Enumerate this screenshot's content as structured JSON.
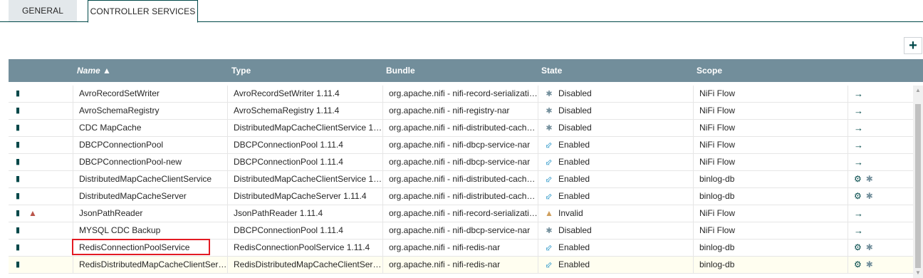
{
  "tabs": [
    {
      "label": "GENERAL"
    },
    {
      "label": "CONTROLLER SERVICES"
    }
  ],
  "add_button": {
    "label": "+"
  },
  "columns": {
    "name": "Name ▲",
    "type": "Type",
    "bundle": "Bundle",
    "state": "State",
    "scope": "Scope"
  },
  "rows": [
    {
      "name": "AvroRecordSetWriter",
      "type": "AvroRecordSetWriter 1.11.4",
      "bundle": "org.apache.nifi - nifi-record-serializati…",
      "state": "Disabled",
      "scope": "NiFi Flow"
    },
    {
      "name": "AvroSchemaRegistry",
      "type": "AvroSchemaRegistry 1.11.4",
      "bundle": "org.apache.nifi - nifi-registry-nar",
      "state": "Disabled",
      "scope": "NiFi Flow"
    },
    {
      "name": "CDC MapCache",
      "type": "DistributedMapCacheClientService 1…",
      "bundle": "org.apache.nifi - nifi-distributed-cach…",
      "state": "Disabled",
      "scope": "NiFi Flow"
    },
    {
      "name": "DBCPConnectionPool",
      "type": "DBCPConnectionPool 1.11.4",
      "bundle": "org.apache.nifi - nifi-dbcp-service-nar",
      "state": "Enabled",
      "scope": "NiFi Flow"
    },
    {
      "name": "DBCPConnectionPool-new",
      "type": "DBCPConnectionPool 1.11.4",
      "bundle": "org.apache.nifi - nifi-dbcp-service-nar",
      "state": "Enabled",
      "scope": "NiFi Flow"
    },
    {
      "name": "DistributedMapCacheClientService",
      "type": "DistributedMapCacheClientService 1…",
      "bundle": "org.apache.nifi - nifi-distributed-cach…",
      "state": "Enabled",
      "scope": "binlog-db"
    },
    {
      "name": "DistributedMapCacheServer",
      "type": "DistributedMapCacheServer 1.11.4",
      "bundle": "org.apache.nifi - nifi-distributed-cach…",
      "state": "Enabled",
      "scope": "binlog-db"
    },
    {
      "name": "JsonPathReader",
      "type": "JsonPathReader 1.11.4",
      "bundle": "org.apache.nifi - nifi-record-serializati…",
      "state": "Invalid",
      "scope": "NiFi Flow"
    },
    {
      "name": "MYSQL CDC Backup",
      "type": "DBCPConnectionPool 1.11.4",
      "bundle": "org.apache.nifi - nifi-dbcp-service-nar",
      "state": "Disabled",
      "scope": "NiFi Flow"
    },
    {
      "name": "RedisConnectionPoolService",
      "type": "RedisConnectionPoolService 1.11.4",
      "bundle": "org.apache.nifi - nifi-redis-nar",
      "state": "Enabled",
      "scope": "binlog-db"
    },
    {
      "name": "RedisDistributedMapCacheClientSer…",
      "type": "RedisDistributedMapCacheClientSer…",
      "bundle": "org.apache.nifi - nifi-redis-nar",
      "state": "Enabled",
      "scope": "binlog-db"
    }
  ],
  "icons": {
    "document": "document-icon",
    "warning": "warning-icon",
    "disabled": "disabled-state-icon",
    "enabled": "enabled-bolt-icon",
    "invalid": "invalid-warning-icon",
    "goto": "go-to-arrow-icon",
    "configure": "gear-icon",
    "disable": "disable-icon"
  },
  "colors": {
    "header_bg": "#728e9b",
    "accent": "#004849",
    "enabled": "#44a3cf",
    "invalid": "#cf9f5d",
    "highlight_box": "#e31b23"
  }
}
